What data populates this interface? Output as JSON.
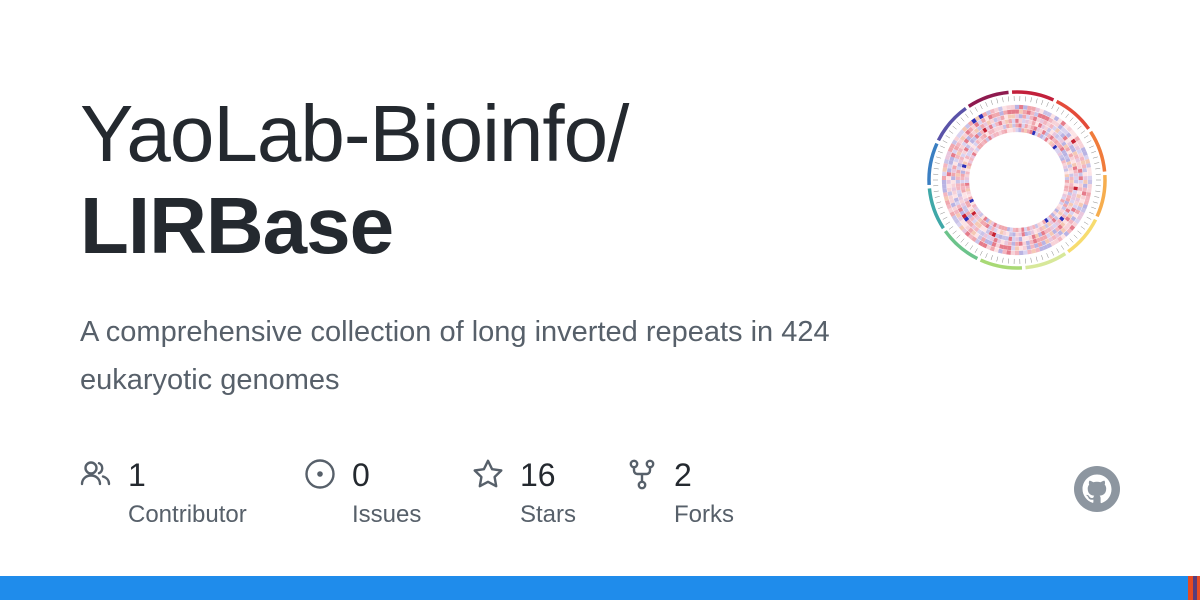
{
  "repo": {
    "owner": "YaoLab-Bioinfo/",
    "name": "LIRBase",
    "description": "A comprehensive collection of long inverted repeats in 424 eukaryotic genomes"
  },
  "stats": [
    {
      "icon": "people-icon",
      "count": "1",
      "label": "Contributor"
    },
    {
      "icon": "issue-circle-icon",
      "count": "0",
      "label": "Issues"
    },
    {
      "icon": "star-icon",
      "count": "16",
      "label": "Stars"
    },
    {
      "icon": "fork-icon",
      "count": "2",
      "label": "Forks"
    }
  ],
  "avatar": {
    "icon": "circos-plot-image"
  },
  "footer_logo": {
    "icon": "github-octocat-icon"
  },
  "colors": {
    "title": "#24292f",
    "muted": "#57606a",
    "language_bar": [
      "#1f8ceb",
      "#e44b23",
      "#563d7c",
      "#e34c26"
    ]
  }
}
